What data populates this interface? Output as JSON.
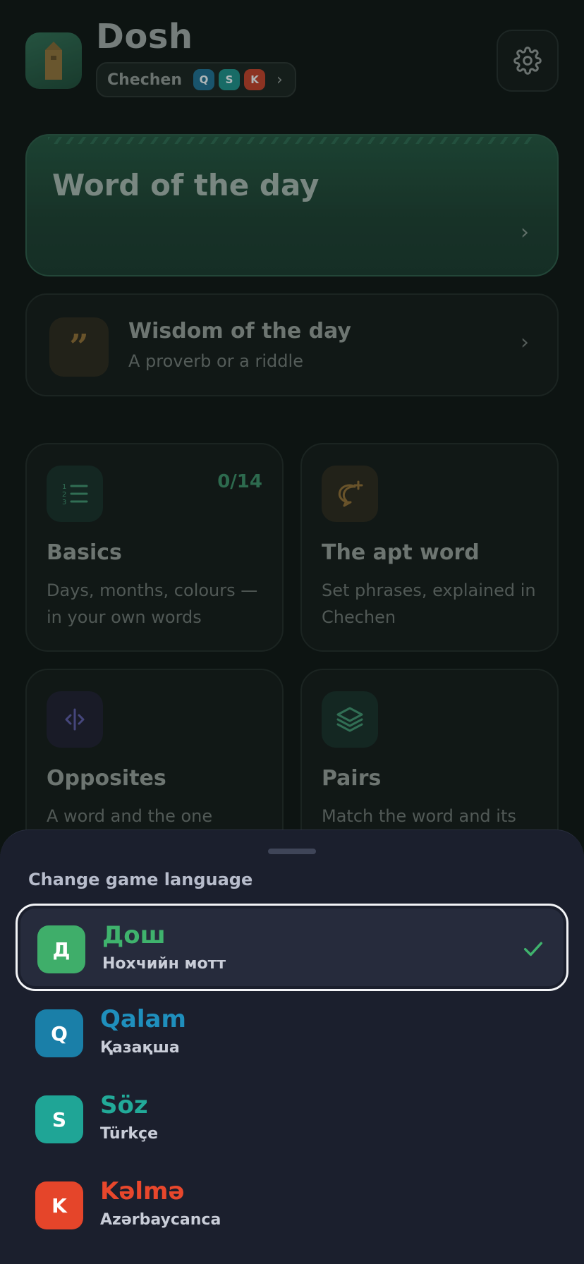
{
  "header": {
    "app_title": "Dosh",
    "language_name": "Chechen",
    "language_badges": [
      {
        "letter": "Q",
        "color": "#1f6d8c"
      },
      {
        "letter": "S",
        "color": "#1e8b85"
      },
      {
        "letter": "K",
        "color": "#b8402a"
      }
    ],
    "icons": {
      "app": "tower-icon",
      "settings": "gear-icon",
      "chevron": "chevron-right-icon"
    }
  },
  "word_of_the_day": {
    "label": "Word of the day"
  },
  "wisdom": {
    "title": "Wisdom of the day",
    "subtitle": "A proverb or a riddle",
    "icon": "quote-icon"
  },
  "cards": [
    {
      "title": "Basics",
      "description": "Days, months, colours — in your own words",
      "progress": "0/14",
      "icon": "numbered-list-icon"
    },
    {
      "title": "The apt word",
      "description": "Set phrases, explained in Chechen",
      "icon": "chat-plus-icon"
    },
    {
      "title": "Opposites",
      "description": "A word and the one",
      "icon": "opposites-icon"
    },
    {
      "title": "Pairs",
      "description": "Match the word and its",
      "icon": "layers-icon"
    }
  ],
  "sheet": {
    "title": "Change game language",
    "options": [
      {
        "badge": "Д",
        "name": "Дош",
        "language": "Нохчийн мотт",
        "color": "#3fae6a",
        "name_color": "#3fb36d",
        "selected": true
      },
      {
        "badge": "Q",
        "name": "Qalam",
        "language": "Қазақша",
        "color": "#1a7fa8",
        "name_color": "#1f8fbd",
        "selected": false
      },
      {
        "badge": "S",
        "name": "Söz",
        "language": "Türkçe",
        "color": "#1fa596",
        "name_color": "#22aa99",
        "selected": false
      },
      {
        "badge": "K",
        "name": "Kəlmə",
        "language": "Azərbaycanca",
        "color": "#e5452a",
        "name_color": "#e8472c",
        "selected": false
      }
    ]
  }
}
